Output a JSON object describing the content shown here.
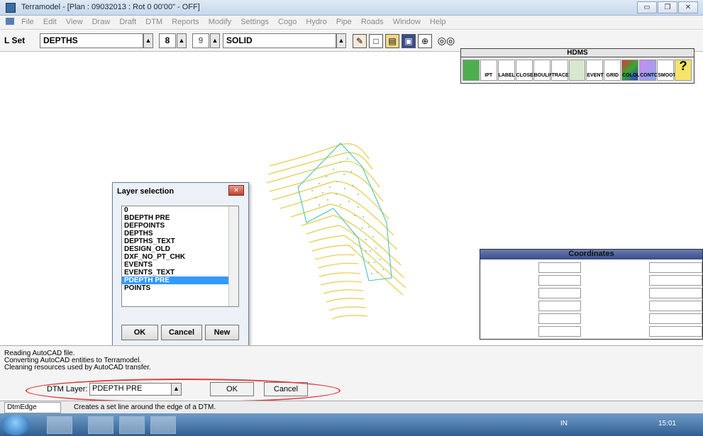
{
  "window": {
    "title": "Terramodel - [Plan : 09032013 : Rot 0 00'00\" - OFF]"
  },
  "menu": [
    "File",
    "Edit",
    "View",
    "Draw",
    "Draft",
    "DTM",
    "Reports",
    "Modify",
    "Settings",
    "Cogo",
    "Hydro",
    "Pipe",
    "Roads",
    "Window",
    "Help"
  ],
  "toolbar": {
    "lset_label": "L Set",
    "layer_value": "DEPTHS",
    "color_value": "8",
    "weight_value": "9",
    "linetype_value": "SOLID"
  },
  "hdms": {
    "title": "HDMS",
    "buttons": [
      "",
      "IPT",
      "LABEL",
      "CLOSE",
      "BOULINE",
      "TRACE",
      "",
      "EVENT",
      "GRID",
      "COLOUR",
      "CONTOUR",
      "SMOOTH",
      ""
    ]
  },
  "coordinates": {
    "title": "Coordinates"
  },
  "layer_dialog": {
    "title": "Layer selection",
    "items": [
      "0",
      "BDEPTH PRE",
      "DEFPOINTS",
      "DEPTHS",
      "DEPTHS_TEXT",
      "DESIGN_OLD",
      "DXF_NO_PT_CHK",
      "EVENTS",
      "EVENTS_TEXT",
      "PDEPTH PRE",
      "POINTS"
    ],
    "selected": "PDEPTH PRE",
    "ok_label": "OK",
    "cancel_label": "Cancel",
    "new_label": "New"
  },
  "output": {
    "lines": [
      "Reading AutoCAD file.",
      "Converting AutoCAD entities to Terramodel.",
      "Cleaning resources used by AutoCAD transfer."
    ],
    "dtm_layer_label": "DTM Layer:",
    "dtm_layer_value": "PDEPTH PRE",
    "ok_label": "OK",
    "cancel_label": "Cancel"
  },
  "status": {
    "command": "DtmEdge",
    "message": "Creates a set line around the edge of a DTM."
  },
  "taskbar": {
    "lang": "IN",
    "time": "15:01"
  },
  "colors": {
    "contour": "#e6cc4a",
    "points": "#3bbfb0",
    "highlight": "#e23a3a",
    "selection": "#3399ff"
  }
}
